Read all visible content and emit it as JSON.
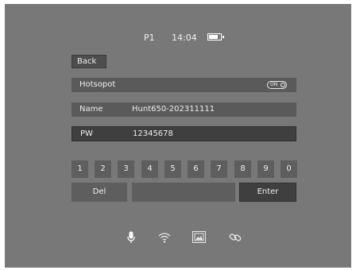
{
  "status": {
    "preset": "P1",
    "time": "14:04",
    "battery_icon": "battery-icon"
  },
  "back_label": "Back",
  "hotspot": {
    "label": "Hotsopot",
    "toggle_text": "ON"
  },
  "name": {
    "label": "Name",
    "value": "Hunt650-202311111"
  },
  "pw": {
    "label": "PW",
    "value": "12345678"
  },
  "keypad": {
    "digits": [
      "1",
      "2",
      "3",
      "4",
      "5",
      "6",
      "7",
      "8",
      "9",
      "0"
    ]
  },
  "keys": {
    "del": "Del",
    "enter": "Enter"
  },
  "bottom_icons": [
    "microphone-icon",
    "wifi-icon",
    "image-frame-icon",
    "link-icon"
  ]
}
